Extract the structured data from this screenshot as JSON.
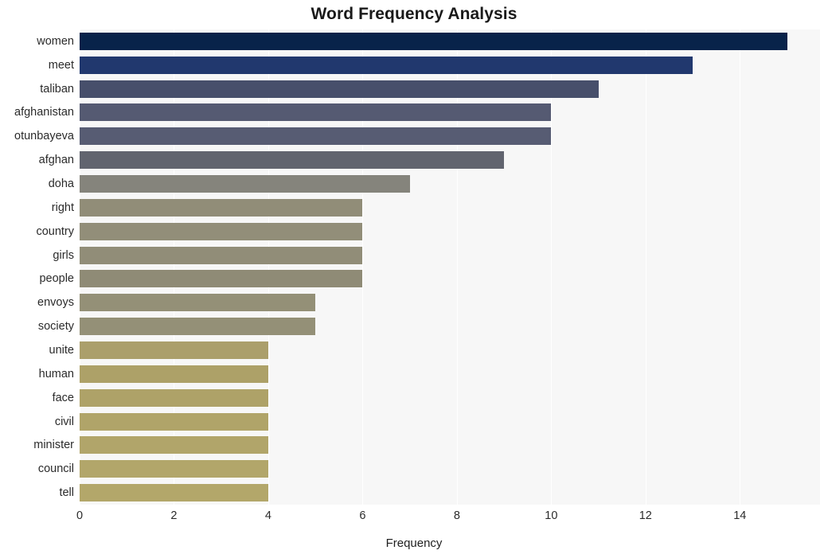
{
  "chart_data": {
    "type": "bar",
    "orientation": "horizontal",
    "title": "Word Frequency Analysis",
    "xlabel": "Frequency",
    "ylabel": "",
    "xlim": [
      0,
      15.7
    ],
    "ylim": [
      0,
      20
    ],
    "grid": true,
    "legend": false,
    "legend_position": "none",
    "xticks": [
      0,
      2,
      4,
      6,
      8,
      10,
      12,
      14
    ],
    "xtick_labels": [
      "0",
      "2",
      "4",
      "6",
      "8",
      "10",
      "12",
      "14"
    ],
    "categories": [
      "women",
      "meet",
      "taliban",
      "afghanistan",
      "otunbayeva",
      "afghan",
      "doha",
      "right",
      "country",
      "girls",
      "people",
      "envoys",
      "society",
      "unite",
      "human",
      "face",
      "civil",
      "minister",
      "council",
      "tell"
    ],
    "values": [
      15,
      13,
      11,
      10,
      10,
      9,
      7,
      6,
      6,
      6,
      6,
      5,
      5,
      4,
      4,
      4,
      4,
      4,
      4,
      4
    ],
    "bar_colors": [
      "#08234a",
      "#21386e",
      "#474f6b",
      "#555a72",
      "#575c73",
      "#61646f",
      "#85847c",
      "#918d78",
      "#928e79",
      "#918d78",
      "#8f8b76",
      "#949077",
      "#949077",
      "#ab9f6b",
      "#ada168",
      "#aea268",
      "#b0a469",
      "#b1a56a",
      "#b2a66a",
      "#b3a76a"
    ],
    "plot_background": "#f7f7f7",
    "gridline_color": "#ffffff",
    "figure_background": "#ffffff"
  }
}
